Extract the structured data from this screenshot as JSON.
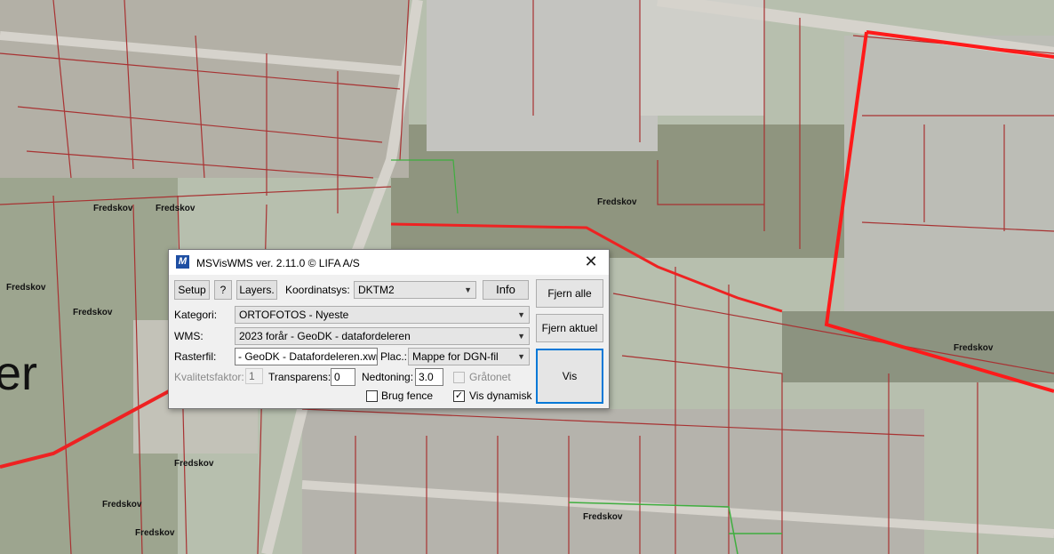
{
  "map": {
    "place_labels": [
      "Fredskov",
      "Fredskov",
      "Fredskov",
      "Fredskov",
      "Fredskov",
      "Fredskov",
      "Fredskov",
      "Fredskov",
      "Fredskov",
      "Fredskov"
    ],
    "big_label": "er"
  },
  "dialog": {
    "title": "MSVisWMS ver. 2.11.0  © LIFA A/S",
    "app_icon": "M",
    "close_glyph": "✕",
    "buttons": {
      "setup": "Setup",
      "help": "?",
      "layers": "Layers.",
      "info": "Info",
      "fjern_alle": "Fjern alle",
      "fjern_aktuel": "Fjern aktuel",
      "vis": "Vis"
    },
    "labels": {
      "koordinatsys": "Koordinatsys:",
      "kategori": "Kategori:",
      "wms": "WMS:",
      "rasterfil": "Rasterfil:",
      "plac": "Plac.:",
      "kvalitetsfaktor": "Kvalitetsfaktor:",
      "transparens": "Transparens:",
      "nedtoning": "Nedtoning:",
      "graatonet": "Gråtonet",
      "brug_fence": "Brug fence",
      "vis_dynamisk": "Vis dynamisk"
    },
    "values": {
      "koordinatsys": "DKTM2",
      "kategori": "ORTOFOTOS - Nyeste",
      "wms": "2023 forår - GeoDK - datafordeleren",
      "rasterfil": "- GeoDK - Datafordeleren.xwms",
      "plac": "Mappe for DGN-fil",
      "kvalitetsfaktor": "1",
      "transparens": "0",
      "nedtoning": "3.0"
    },
    "checks": {
      "graatonet": false,
      "brug_fence": false,
      "vis_dynamisk": true
    },
    "check_glyph": "✓",
    "dropdown_glyph": "▼"
  }
}
